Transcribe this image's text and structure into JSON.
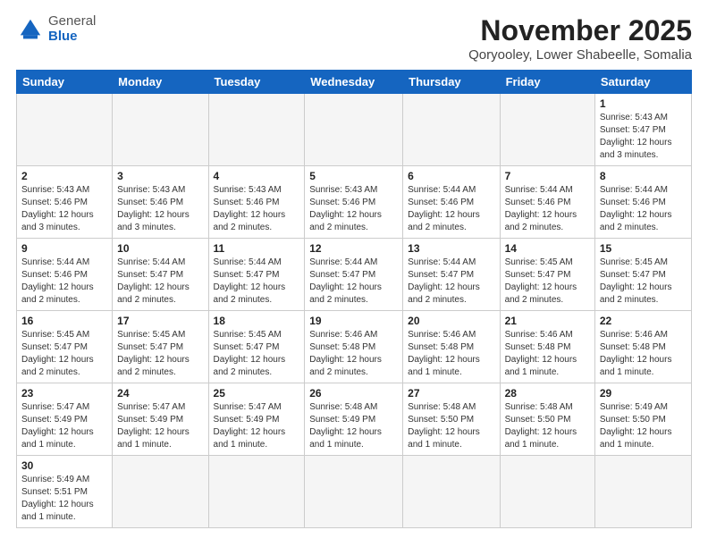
{
  "logo": {
    "general": "General",
    "blue": "Blue"
  },
  "header": {
    "month_year": "November 2025",
    "location": "Qoryooley, Lower Shabeelle, Somalia"
  },
  "days_of_week": [
    "Sunday",
    "Monday",
    "Tuesday",
    "Wednesday",
    "Thursday",
    "Friday",
    "Saturday"
  ],
  "weeks": [
    [
      {
        "day": "",
        "info": ""
      },
      {
        "day": "",
        "info": ""
      },
      {
        "day": "",
        "info": ""
      },
      {
        "day": "",
        "info": ""
      },
      {
        "day": "",
        "info": ""
      },
      {
        "day": "",
        "info": ""
      },
      {
        "day": "1",
        "info": "Sunrise: 5:43 AM\nSunset: 5:47 PM\nDaylight: 12 hours and 3 minutes."
      }
    ],
    [
      {
        "day": "2",
        "info": "Sunrise: 5:43 AM\nSunset: 5:46 PM\nDaylight: 12 hours and 3 minutes."
      },
      {
        "day": "3",
        "info": "Sunrise: 5:43 AM\nSunset: 5:46 PM\nDaylight: 12 hours and 3 minutes."
      },
      {
        "day": "4",
        "info": "Sunrise: 5:43 AM\nSunset: 5:46 PM\nDaylight: 12 hours and 2 minutes."
      },
      {
        "day": "5",
        "info": "Sunrise: 5:43 AM\nSunset: 5:46 PM\nDaylight: 12 hours and 2 minutes."
      },
      {
        "day": "6",
        "info": "Sunrise: 5:44 AM\nSunset: 5:46 PM\nDaylight: 12 hours and 2 minutes."
      },
      {
        "day": "7",
        "info": "Sunrise: 5:44 AM\nSunset: 5:46 PM\nDaylight: 12 hours and 2 minutes."
      },
      {
        "day": "8",
        "info": "Sunrise: 5:44 AM\nSunset: 5:46 PM\nDaylight: 12 hours and 2 minutes."
      }
    ],
    [
      {
        "day": "9",
        "info": "Sunrise: 5:44 AM\nSunset: 5:46 PM\nDaylight: 12 hours and 2 minutes."
      },
      {
        "day": "10",
        "info": "Sunrise: 5:44 AM\nSunset: 5:47 PM\nDaylight: 12 hours and 2 minutes."
      },
      {
        "day": "11",
        "info": "Sunrise: 5:44 AM\nSunset: 5:47 PM\nDaylight: 12 hours and 2 minutes."
      },
      {
        "day": "12",
        "info": "Sunrise: 5:44 AM\nSunset: 5:47 PM\nDaylight: 12 hours and 2 minutes."
      },
      {
        "day": "13",
        "info": "Sunrise: 5:44 AM\nSunset: 5:47 PM\nDaylight: 12 hours and 2 minutes."
      },
      {
        "day": "14",
        "info": "Sunrise: 5:45 AM\nSunset: 5:47 PM\nDaylight: 12 hours and 2 minutes."
      },
      {
        "day": "15",
        "info": "Sunrise: 5:45 AM\nSunset: 5:47 PM\nDaylight: 12 hours and 2 minutes."
      }
    ],
    [
      {
        "day": "16",
        "info": "Sunrise: 5:45 AM\nSunset: 5:47 PM\nDaylight: 12 hours and 2 minutes."
      },
      {
        "day": "17",
        "info": "Sunrise: 5:45 AM\nSunset: 5:47 PM\nDaylight: 12 hours and 2 minutes."
      },
      {
        "day": "18",
        "info": "Sunrise: 5:45 AM\nSunset: 5:47 PM\nDaylight: 12 hours and 2 minutes."
      },
      {
        "day": "19",
        "info": "Sunrise: 5:46 AM\nSunset: 5:48 PM\nDaylight: 12 hours and 2 minutes."
      },
      {
        "day": "20",
        "info": "Sunrise: 5:46 AM\nSunset: 5:48 PM\nDaylight: 12 hours and 1 minute."
      },
      {
        "day": "21",
        "info": "Sunrise: 5:46 AM\nSunset: 5:48 PM\nDaylight: 12 hours and 1 minute."
      },
      {
        "day": "22",
        "info": "Sunrise: 5:46 AM\nSunset: 5:48 PM\nDaylight: 12 hours and 1 minute."
      }
    ],
    [
      {
        "day": "23",
        "info": "Sunrise: 5:47 AM\nSunset: 5:49 PM\nDaylight: 12 hours and 1 minute."
      },
      {
        "day": "24",
        "info": "Sunrise: 5:47 AM\nSunset: 5:49 PM\nDaylight: 12 hours and 1 minute."
      },
      {
        "day": "25",
        "info": "Sunrise: 5:47 AM\nSunset: 5:49 PM\nDaylight: 12 hours and 1 minute."
      },
      {
        "day": "26",
        "info": "Sunrise: 5:48 AM\nSunset: 5:49 PM\nDaylight: 12 hours and 1 minute."
      },
      {
        "day": "27",
        "info": "Sunrise: 5:48 AM\nSunset: 5:50 PM\nDaylight: 12 hours and 1 minute."
      },
      {
        "day": "28",
        "info": "Sunrise: 5:48 AM\nSunset: 5:50 PM\nDaylight: 12 hours and 1 minute."
      },
      {
        "day": "29",
        "info": "Sunrise: 5:49 AM\nSunset: 5:50 PM\nDaylight: 12 hours and 1 minute."
      }
    ],
    [
      {
        "day": "30",
        "info": "Sunrise: 5:49 AM\nSunset: 5:51 PM\nDaylight: 12 hours and 1 minute."
      },
      {
        "day": "",
        "info": ""
      },
      {
        "day": "",
        "info": ""
      },
      {
        "day": "",
        "info": ""
      },
      {
        "day": "",
        "info": ""
      },
      {
        "day": "",
        "info": ""
      },
      {
        "day": "",
        "info": ""
      }
    ]
  ]
}
